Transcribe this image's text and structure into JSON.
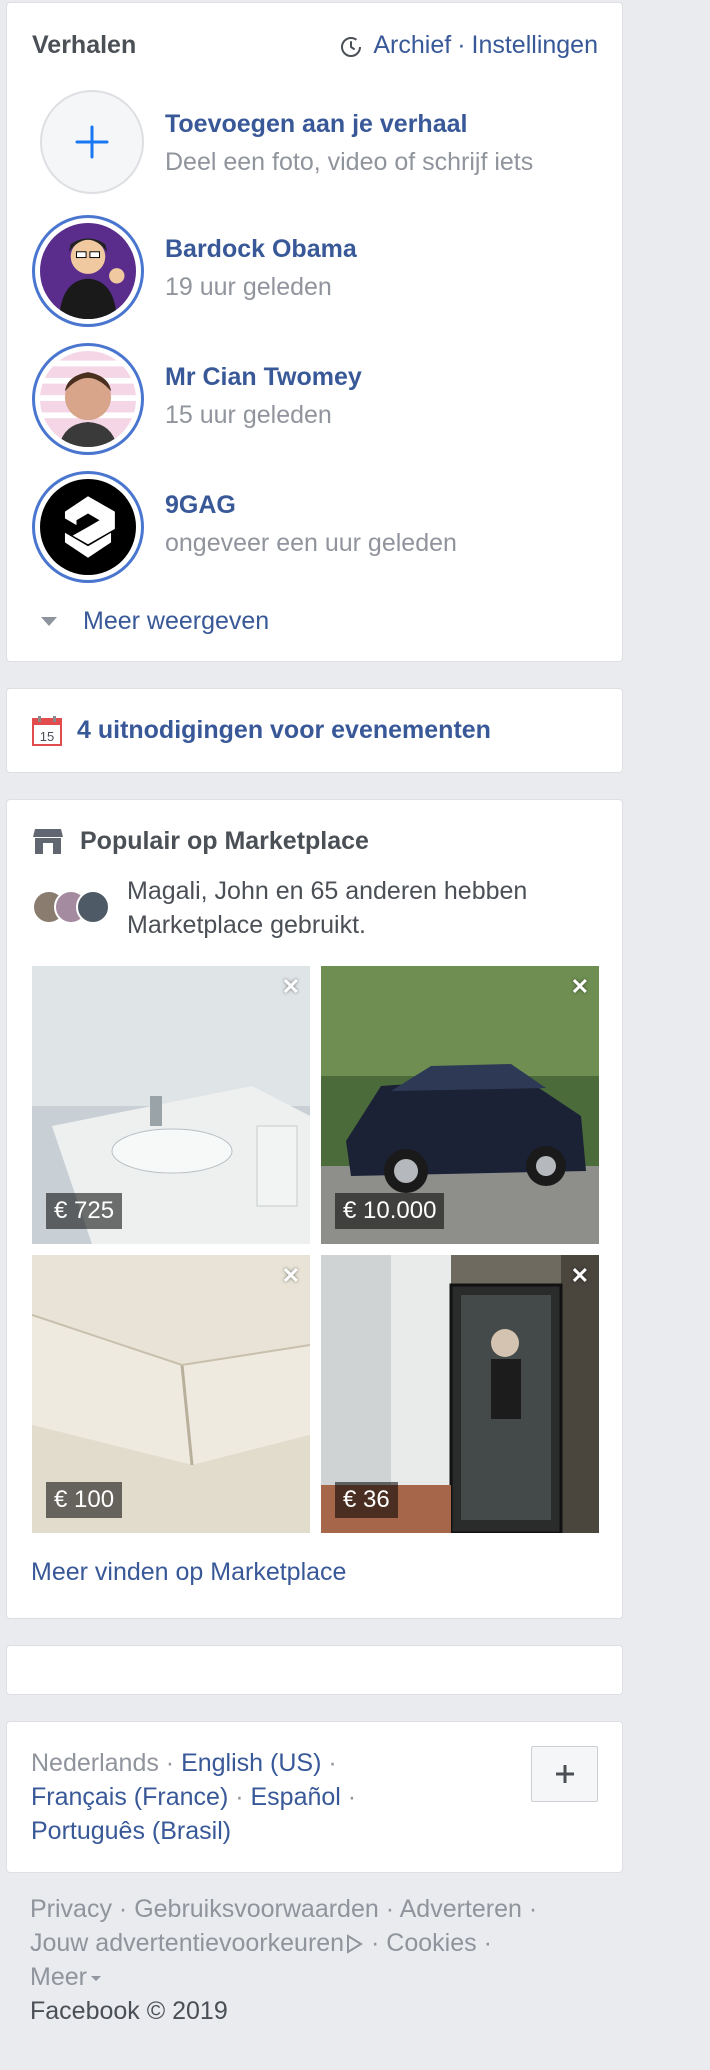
{
  "stories": {
    "title": "Verhalen",
    "archive": "Archief",
    "separator": "·",
    "settings": "Instellingen",
    "add": {
      "title": "Toevoegen aan je verhaal",
      "subtitle": "Deel een foto, video of schrijf iets"
    },
    "items": [
      {
        "name": "Bardock Obama",
        "time": "19 uur geleden"
      },
      {
        "name": "Mr Cian Twomey",
        "time": "15 uur geleden"
      },
      {
        "name": "9GAG",
        "time": "ongeveer een uur geleden"
      }
    ],
    "more": "Meer weergeven"
  },
  "events": {
    "calendar_day": "15",
    "label": "4 uitnodigingen voor evenementen"
  },
  "marketplace": {
    "title": "Populair op Marketplace",
    "description": "Magali, John en 65 anderen hebben Marketplace gebruikt.",
    "items": [
      {
        "price": "€ 725"
      },
      {
        "price": "€ 10.000"
      },
      {
        "price": "€ 100"
      },
      {
        "price": "€ 36"
      }
    ],
    "close_glyph": "✕",
    "more": "Meer vinden op Marketplace"
  },
  "languages": {
    "current": "Nederlands",
    "options": [
      "English (US)",
      "Français (France)",
      "Español",
      "Português (Brasil)"
    ],
    "separator": " · "
  },
  "footer": {
    "links": [
      "Privacy",
      "Gebruiksvoorwaarden",
      "Adverteren",
      "Jouw advertentievoorkeuren",
      "Cookies",
      "Meer"
    ],
    "copyright": "Facebook © 2019"
  },
  "colors": {
    "link": "#385898",
    "muted": "#90949c",
    "background": "#e9ebee",
    "story_ring": "#4a76d0"
  }
}
